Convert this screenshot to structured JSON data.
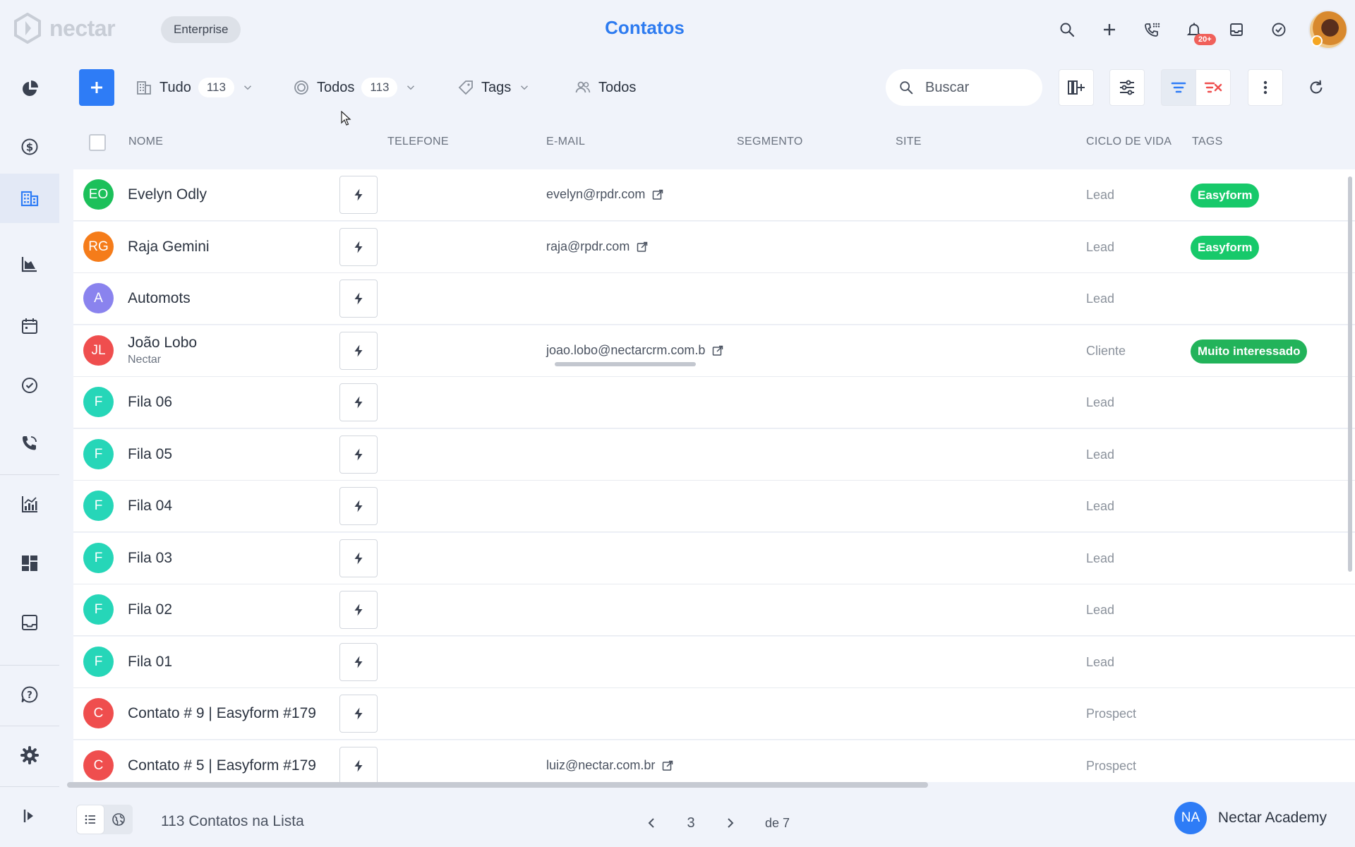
{
  "app": {
    "logo_text": "nectar",
    "plan": "Enterprise",
    "title": "Contatos"
  },
  "topbar": {
    "actions": [
      {
        "name": "search-icon"
      },
      {
        "name": "plus-icon"
      },
      {
        "name": "phone-dialpad-icon"
      },
      {
        "name": "bell-icon",
        "badge": "20+"
      },
      {
        "name": "inbox-icon"
      },
      {
        "name": "check-circle-icon"
      }
    ]
  },
  "leftnav": {
    "items": [
      "pie-chart-icon",
      "dollar-icon",
      "building-icon",
      "funnel-chart-icon",
      "calendar-icon",
      "check-circle-icon",
      "phone-icon",
      "bar-chart-icon",
      "dashboard-icon",
      "inbox-icon",
      "help-icon",
      "gear-icon",
      "expand-icon"
    ],
    "active": "building-icon"
  },
  "toolbar": {
    "filter_all": {
      "label": "Tudo",
      "count": "113"
    },
    "filter_status": {
      "label": "Todos",
      "count": "113"
    },
    "filter_tags": {
      "label": "Tags"
    },
    "filter_owners": {
      "label": "Todos"
    },
    "search_placeholder": "Buscar"
  },
  "table": {
    "columns": {
      "name": "NOME",
      "phone": "TELEFONE",
      "email": "E-MAIL",
      "segment": "SEGMENTO",
      "site": "SITE",
      "lifecycle": "CICLO DE VIDA",
      "tags": "TAGS"
    },
    "rows": [
      {
        "initials": "EO",
        "color": "#1cc05a",
        "name": "Evelyn Odly",
        "company": "",
        "email": "evelyn@rpdr.com",
        "lifecycle": "Lead",
        "tag": "Easyform",
        "tag_color": "#17c96a"
      },
      {
        "initials": "RG",
        "color": "#f57c1a",
        "name": "Raja Gemini",
        "company": "",
        "email": "raja@rpdr.com",
        "lifecycle": "Lead",
        "tag": "Easyform",
        "tag_color": "#17c96a"
      },
      {
        "initials": "A",
        "color": "#8a83ee",
        "name": "Automots",
        "company": "",
        "email": "",
        "lifecycle": "Lead",
        "tag": "",
        "tag_color": ""
      },
      {
        "initials": "JL",
        "color": "#ef4e4e",
        "name": "João Lobo",
        "company": "Nectar",
        "email": "joao.lobo@nectarcrm.com.b",
        "lifecycle": "Cliente",
        "tag": "Muito interessado",
        "tag_color": "#22b35a"
      },
      {
        "initials": "F",
        "color": "#26d6b8",
        "name": "Fila 06",
        "company": "",
        "email": "",
        "lifecycle": "Lead",
        "tag": "",
        "tag_color": ""
      },
      {
        "initials": "F",
        "color": "#26d6b8",
        "name": "Fila 05",
        "company": "",
        "email": "",
        "lifecycle": "Lead",
        "tag": "",
        "tag_color": ""
      },
      {
        "initials": "F",
        "color": "#26d6b8",
        "name": "Fila 04",
        "company": "",
        "email": "",
        "lifecycle": "Lead",
        "tag": "",
        "tag_color": ""
      },
      {
        "initials": "F",
        "color": "#26d6b8",
        "name": "Fila 03",
        "company": "",
        "email": "",
        "lifecycle": "Lead",
        "tag": "",
        "tag_color": ""
      },
      {
        "initials": "F",
        "color": "#26d6b8",
        "name": "Fila 02",
        "company": "",
        "email": "",
        "lifecycle": "Lead",
        "tag": "",
        "tag_color": ""
      },
      {
        "initials": "F",
        "color": "#26d6b8",
        "name": "Fila 01",
        "company": "",
        "email": "",
        "lifecycle": "Lead",
        "tag": "",
        "tag_color": ""
      },
      {
        "initials": "C",
        "color": "#ef4e4e",
        "name": "Contato # 9 | Easyform #179",
        "company": "",
        "email": "",
        "lifecycle": "Prospect",
        "tag": "",
        "tag_color": ""
      },
      {
        "initials": "C",
        "color": "#ef4e4e",
        "name": "Contato # 5 | Easyform #179",
        "company": "",
        "email": "luiz@nectar.com.br",
        "lifecycle": "Prospect",
        "tag": "",
        "tag_color": ""
      }
    ]
  },
  "footer": {
    "list_count": "113 Contatos na Lista",
    "page": "3",
    "of_pages": "de 7",
    "user_initials": "NA",
    "user_name": "Nectar Academy"
  },
  "colors": {
    "accent": "#2e7cf6",
    "title": "#2d7bf0",
    "danger": "#f0605a"
  }
}
